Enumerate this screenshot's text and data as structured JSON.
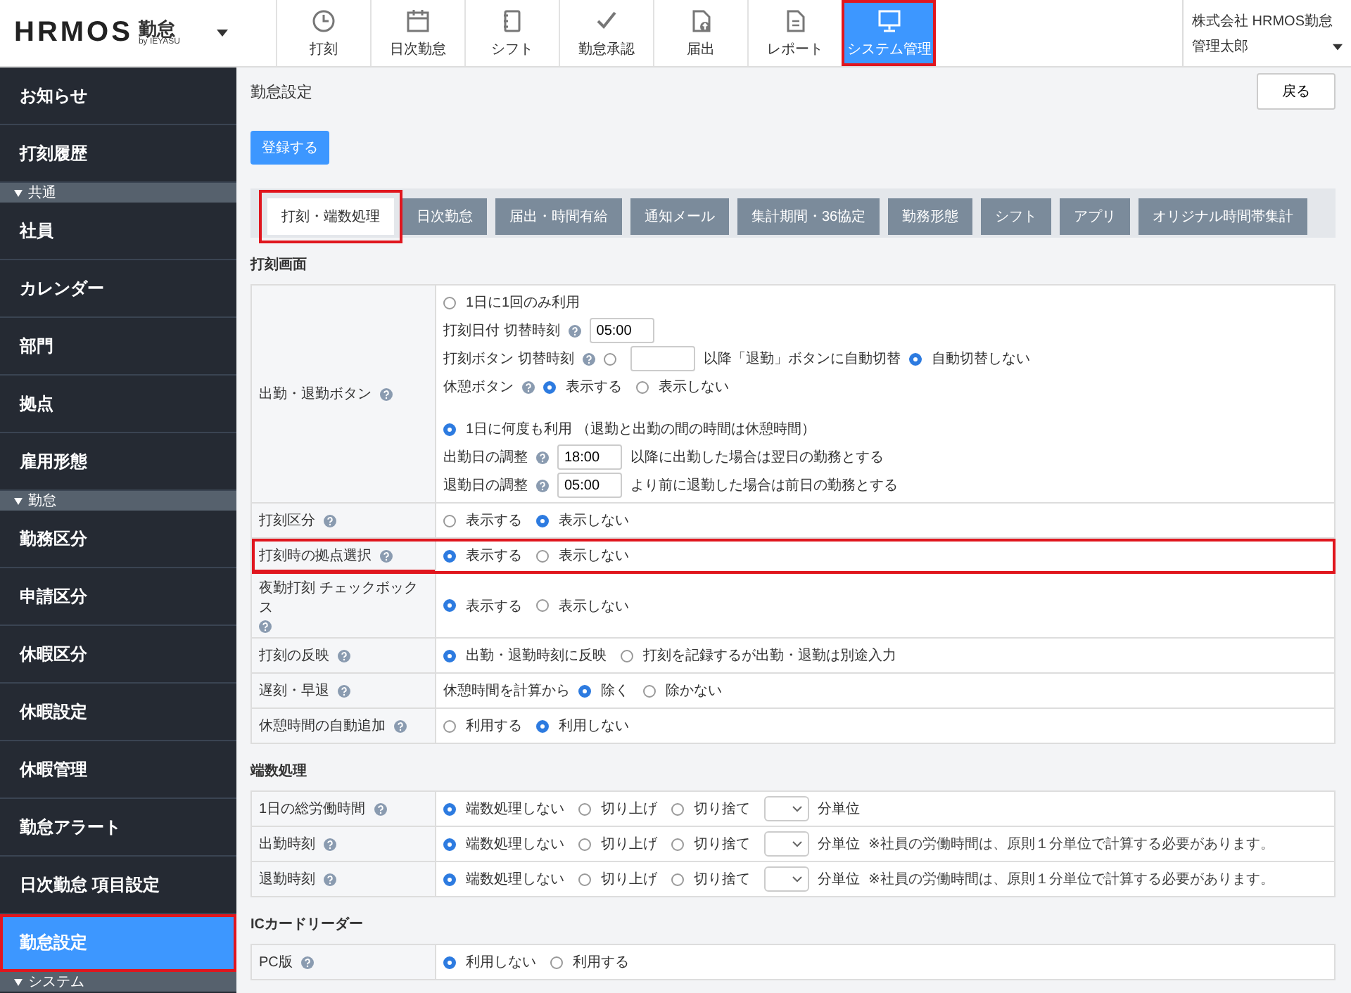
{
  "header": {
    "brand": "HRMOS",
    "product": "勤怠",
    "byline": "by IEYASU",
    "company": "株式会社 HRMOS勤怠",
    "user": "管理太郎",
    "nav": [
      {
        "label": "打刻",
        "selected": false,
        "highlighted": false
      },
      {
        "label": "日次勤怠",
        "selected": false,
        "highlighted": false
      },
      {
        "label": "シフト",
        "selected": false,
        "highlighted": false
      },
      {
        "label": "勤怠承認",
        "selected": false,
        "highlighted": false
      },
      {
        "label": "届出",
        "selected": false,
        "highlighted": false
      },
      {
        "label": "レポート",
        "selected": false,
        "highlighted": false
      },
      {
        "label": "システム管理",
        "selected": true,
        "highlighted": true
      }
    ]
  },
  "sidebar": {
    "items": [
      {
        "kind": "item",
        "label": "お知らせ",
        "selected": false,
        "highlighted": false
      },
      {
        "kind": "item",
        "label": "打刻履歴",
        "selected": false,
        "highlighted": false
      },
      {
        "kind": "section",
        "label": "共通"
      },
      {
        "kind": "item",
        "label": "社員",
        "selected": false,
        "highlighted": false
      },
      {
        "kind": "item",
        "label": "カレンダー",
        "selected": false,
        "highlighted": false
      },
      {
        "kind": "item",
        "label": "部門",
        "selected": false,
        "highlighted": false
      },
      {
        "kind": "item",
        "label": "拠点",
        "selected": false,
        "highlighted": false
      },
      {
        "kind": "item",
        "label": "雇用形態",
        "selected": false,
        "highlighted": false
      },
      {
        "kind": "section",
        "label": "勤怠"
      },
      {
        "kind": "item",
        "label": "勤務区分",
        "selected": false,
        "highlighted": false
      },
      {
        "kind": "item",
        "label": "申請区分",
        "selected": false,
        "highlighted": false
      },
      {
        "kind": "item",
        "label": "休暇区分",
        "selected": false,
        "highlighted": false
      },
      {
        "kind": "item",
        "label": "休暇設定",
        "selected": false,
        "highlighted": false
      },
      {
        "kind": "item",
        "label": "休暇管理",
        "selected": false,
        "highlighted": false
      },
      {
        "kind": "item",
        "label": "勤怠アラート",
        "selected": false,
        "highlighted": false
      },
      {
        "kind": "item",
        "label": "日次勤怠 項目設定",
        "selected": false,
        "highlighted": false
      },
      {
        "kind": "item",
        "label": "勤怠設定",
        "selected": true,
        "highlighted": true
      },
      {
        "kind": "section",
        "label": "システム"
      }
    ]
  },
  "page": {
    "title": "勤怠設定",
    "back_button": "戻る",
    "save_button": "登録する",
    "tabs": [
      {
        "label": "打刻・端数処理",
        "selected": true,
        "highlighted": true
      },
      {
        "label": "日次勤怠",
        "selected": false,
        "highlighted": false
      },
      {
        "label": "届出・時間有給",
        "selected": false,
        "highlighted": false
      },
      {
        "label": "通知メール",
        "selected": false,
        "highlighted": false
      },
      {
        "label": "集計期間・36協定",
        "selected": false,
        "highlighted": false
      },
      {
        "label": "勤務形態",
        "selected": false,
        "highlighted": false
      },
      {
        "label": "シフト",
        "selected": false,
        "highlighted": false
      },
      {
        "label": "アプリ",
        "selected": false,
        "highlighted": false
      },
      {
        "label": "オリジナル時間帯集計",
        "selected": false,
        "highlighted": false
      }
    ],
    "sections": [
      {
        "title": "打刻画面",
        "rows": [
          {
            "label": "出勤・退勤ボタン",
            "help": true,
            "highlighted": false,
            "groups": [
              [
                [
                  {
                    "kind": "radio",
                    "label": "1日に1回のみ利用",
                    "selected": false
                  }
                ],
                [
                  {
                    "kind": "text",
                    "text": "打刻日付 切替時刻"
                  },
                  {
                    "kind": "help"
                  },
                  {
                    "kind": "input",
                    "value": "05:00"
                  }
                ],
                [
                  {
                    "kind": "text",
                    "text": "打刻ボタン 切替時刻"
                  },
                  {
                    "kind": "help"
                  },
                  {
                    "kind": "radio",
                    "selected": false
                  },
                  {
                    "kind": "input"
                  },
                  {
                    "kind": "text",
                    "text": "以降「退勤」ボタンに自動切替"
                  },
                  {
                    "kind": "radio",
                    "label": "自動切替しない",
                    "selected": true
                  }
                ],
                [
                  {
                    "kind": "text",
                    "text": "休憩ボタン"
                  },
                  {
                    "kind": "help"
                  },
                  {
                    "kind": "radio",
                    "label": "表示する",
                    "selected": true
                  },
                  {
                    "kind": "radio",
                    "label": "表示しない",
                    "selected": false
                  }
                ]
              ],
              [
                [
                  {
                    "kind": "radio",
                    "label": "1日に何度も利用 （退勤と出勤の間の時間は休憩時間）",
                    "selected": true
                  }
                ],
                [
                  {
                    "kind": "text",
                    "text": "出勤日の調整"
                  },
                  {
                    "kind": "help"
                  },
                  {
                    "kind": "input",
                    "value": "18:00"
                  },
                  {
                    "kind": "text",
                    "text": "以降に出勤した場合は翌日の勤務とする"
                  }
                ],
                [
                  {
                    "kind": "text",
                    "text": "退勤日の調整"
                  },
                  {
                    "kind": "help"
                  },
                  {
                    "kind": "input",
                    "value": "05:00"
                  },
                  {
                    "kind": "text",
                    "text": "より前に退勤した場合は前日の勤務とする"
                  }
                ]
              ]
            ]
          },
          {
            "label": "打刻区分",
            "help": true,
            "highlighted": false,
            "groups": [
              [
                [
                  {
                    "kind": "radio",
                    "label": "表示する",
                    "selected": false
                  },
                  {
                    "kind": "radio",
                    "label": "表示しない",
                    "selected": true
                  }
                ]
              ]
            ]
          },
          {
            "label": "打刻時の拠点選択",
            "help": true,
            "highlighted": true,
            "groups": [
              [
                [
                  {
                    "kind": "radio",
                    "label": "表示する",
                    "selected": true
                  },
                  {
                    "kind": "radio",
                    "label": "表示しない",
                    "selected": false
                  }
                ]
              ]
            ]
          },
          {
            "label": "夜勤打刻 チェックボックス",
            "help": true,
            "highlighted": false,
            "groups": [
              [
                [
                  {
                    "kind": "radio",
                    "label": "表示する",
                    "selected": true
                  },
                  {
                    "kind": "radio",
                    "label": "表示しない",
                    "selected": false
                  }
                ]
              ]
            ]
          },
          {
            "label": "打刻の反映",
            "help": true,
            "highlighted": false,
            "groups": [
              [
                [
                  {
                    "kind": "radio",
                    "label": "出勤・退勤時刻に反映",
                    "selected": true
                  },
                  {
                    "kind": "radio",
                    "label": "打刻を記録するが出勤・退勤は別途入力",
                    "selected": false
                  }
                ]
              ]
            ]
          },
          {
            "label": "遅刻・早退",
            "help": true,
            "highlighted": false,
            "groups": [
              [
                [
                  {
                    "kind": "text",
                    "text": "休憩時間を計算から"
                  },
                  {
                    "kind": "radio",
                    "label": "除く",
                    "selected": true
                  },
                  {
                    "kind": "radio",
                    "label": "除かない",
                    "selected": false
                  }
                ]
              ]
            ]
          },
          {
            "label": "休憩時間の自動追加",
            "help": true,
            "highlighted": false,
            "groups": [
              [
                [
                  {
                    "kind": "radio",
                    "label": "利用する",
                    "selected": false
                  },
                  {
                    "kind": "radio",
                    "label": "利用しない",
                    "selected": true
                  }
                ]
              ]
            ]
          }
        ]
      },
      {
        "title": "端数処理",
        "rows": [
          {
            "label": "1日の総労働時間",
            "help": true,
            "highlighted": false,
            "groups": [
              [
                [
                  {
                    "kind": "radio",
                    "label": "端数処理しない",
                    "selected": true
                  },
                  {
                    "kind": "radio",
                    "label": "切り上げ",
                    "selected": false
                  },
                  {
                    "kind": "radio",
                    "label": "切り捨て",
                    "selected": false
                  },
                  {
                    "kind": "select"
                  },
                  {
                    "kind": "text",
                    "text": "分単位"
                  }
                ]
              ]
            ]
          },
          {
            "label": "出勤時刻",
            "help": true,
            "highlighted": false,
            "groups": [
              [
                [
                  {
                    "kind": "radio",
                    "label": "端数処理しない",
                    "selected": true
                  },
                  {
                    "kind": "radio",
                    "label": "切り上げ",
                    "selected": false
                  },
                  {
                    "kind": "radio",
                    "label": "切り捨て",
                    "selected": false
                  },
                  {
                    "kind": "select"
                  },
                  {
                    "kind": "text",
                    "text": "分単位"
                  },
                  {
                    "kind": "note",
                    "text": "※社員の労働時間は、原則１分単位で計算する必要があります。"
                  }
                ]
              ]
            ]
          },
          {
            "label": "退勤時刻",
            "help": true,
            "highlighted": false,
            "groups": [
              [
                [
                  {
                    "kind": "radio",
                    "label": "端数処理しない",
                    "selected": true
                  },
                  {
                    "kind": "radio",
                    "label": "切り上げ",
                    "selected": false
                  },
                  {
                    "kind": "radio",
                    "label": "切り捨て",
                    "selected": false
                  },
                  {
                    "kind": "select"
                  },
                  {
                    "kind": "text",
                    "text": "分単位"
                  },
                  {
                    "kind": "note",
                    "text": "※社員の労働時間は、原則１分単位で計算する必要があります。"
                  }
                ]
              ]
            ]
          }
        ]
      },
      {
        "title": "ICカードリーダー",
        "rows": [
          {
            "label": "PC版",
            "help": true,
            "highlighted": false,
            "groups": [
              [
                [
                  {
                    "kind": "radio",
                    "label": "利用しない",
                    "selected": true
                  },
                  {
                    "kind": "radio",
                    "label": "利用する",
                    "selected": false
                  }
                ]
              ]
            ]
          }
        ]
      }
    ]
  }
}
